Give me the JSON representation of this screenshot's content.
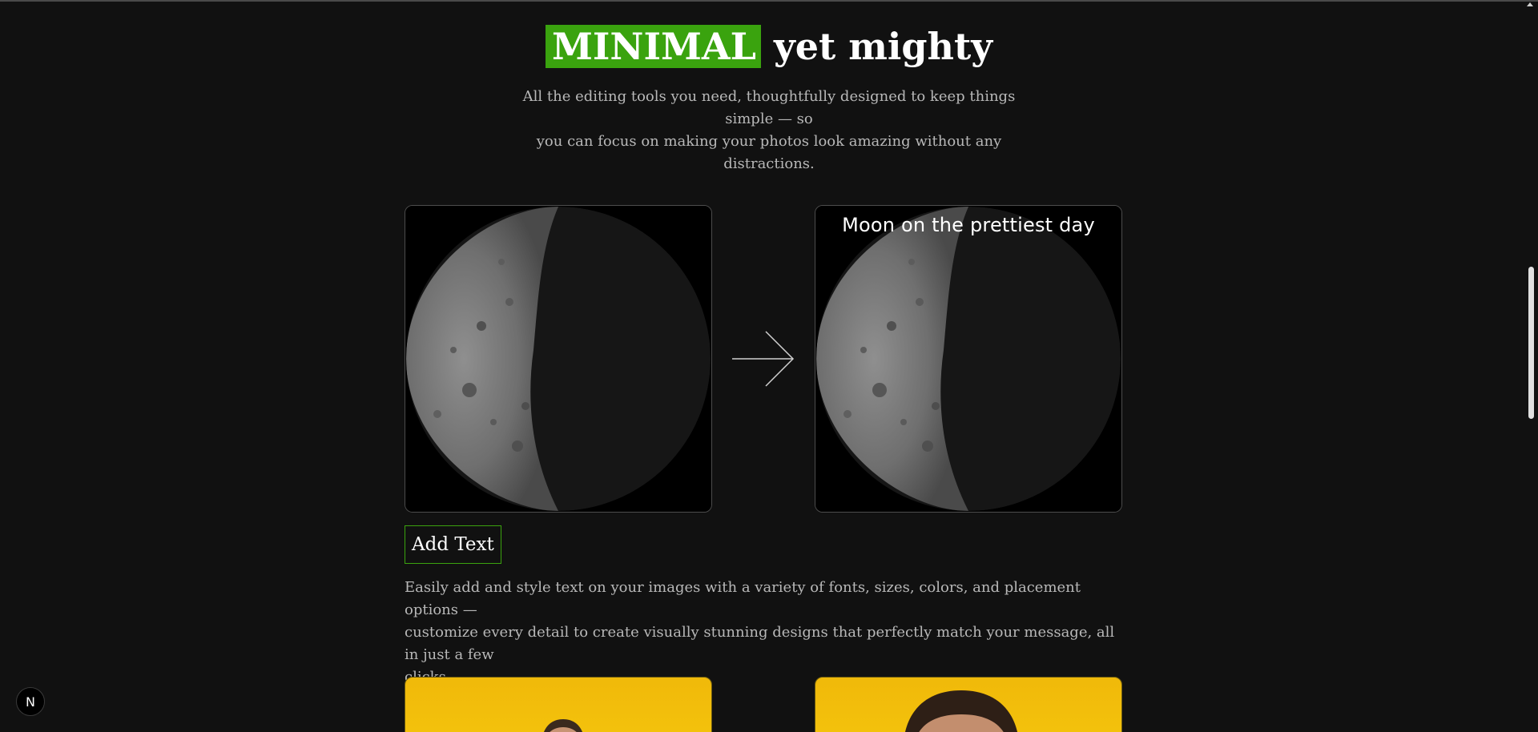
{
  "hero": {
    "title_highlight": "MINIMAL",
    "title_rest": "yet mighty",
    "subtitle_line1": "All the editing tools you need, thoughtfully designed to keep things simple — so",
    "subtitle_line2": "you can focus on making your photos look amazing without any distractions."
  },
  "feature": {
    "overlay_text": "Moon on the prettiest day",
    "button_label": "Add Text",
    "description_line1": "Easily add and style text on your images with a variety of fonts, sizes, colors, and placement options —",
    "description_line2": "customize every detail to create visually stunning designs that perfectly match your message, all in just a few",
    "description_line3": "clicks."
  },
  "badge": {
    "label": "N"
  },
  "colors": {
    "accent": "#3aa30e",
    "background": "#111111",
    "subtext": "#b8b8b8",
    "thumb_yellow": "#f2bd0b"
  },
  "icons": {
    "arrow": "arrow-right-icon",
    "badge": "nextjs-logo-icon"
  }
}
